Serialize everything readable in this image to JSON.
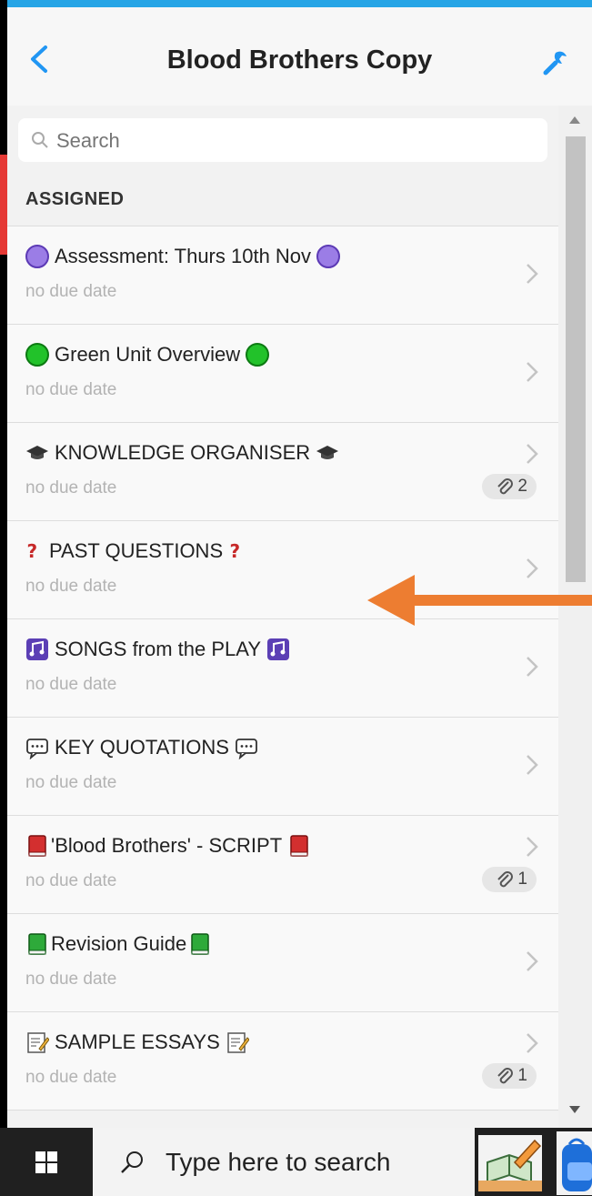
{
  "header": {
    "title": "Blood Brothers Copy"
  },
  "search": {
    "placeholder": "Search"
  },
  "section": {
    "label": "ASSIGNED"
  },
  "items": [
    {
      "title": "Assessment: Thurs 10th Nov",
      "due": "no due date",
      "emoji": "purple-circle"
    },
    {
      "title": "Green Unit Overview",
      "due": "no due date",
      "emoji": "green-circle"
    },
    {
      "title": "KNOWLEDGE ORGANISER",
      "due": "no due date",
      "emoji": "graduation-cap",
      "attachments": "2"
    },
    {
      "title": "PAST QUESTIONS",
      "due": "no due date",
      "emoji": "question-mark"
    },
    {
      "title": "SONGS from the PLAY",
      "due": "no due date",
      "emoji": "music-notes"
    },
    {
      "title": "KEY QUOTATIONS",
      "due": "no due date",
      "emoji": "speech-bubble"
    },
    {
      "title": "'Blood Brothers' - SCRIPT",
      "due": "no due date",
      "emoji": "red-book",
      "attachments": "1"
    },
    {
      "title": "Revision Guide",
      "due": "no due date",
      "emoji": "green-book"
    },
    {
      "title": "SAMPLE ESSAYS",
      "due": "no due date",
      "emoji": "memo",
      "attachments": "1"
    }
  ],
  "taskbar": {
    "search_placeholder": "Type here to search"
  },
  "colors": {
    "accent": "#27a5e6",
    "arrow": "#ed7d31",
    "purple": "#9b7de6",
    "green": "#22c22a"
  }
}
